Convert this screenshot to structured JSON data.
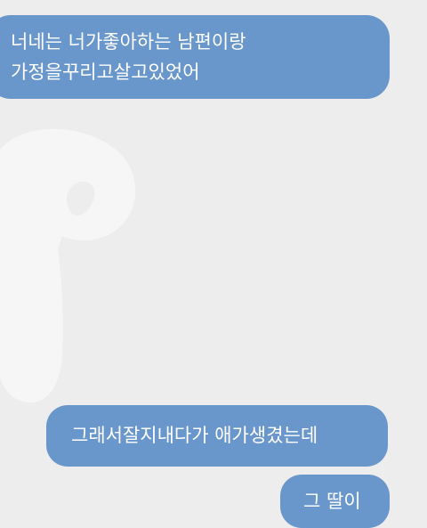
{
  "messages": [
    {
      "lines": [
        "너네는 너가좋아하는 남편이랑",
        "가정을꾸리고살고있었어"
      ]
    },
    {
      "lines": [
        "그래서잘지내다가 애가생겼는데"
      ]
    },
    {
      "lines": [
        "그 딸이"
      ]
    }
  ],
  "colors": {
    "bubble": "#6a97cb",
    "background": "#ededed",
    "bubble_text": "#ffffff"
  }
}
